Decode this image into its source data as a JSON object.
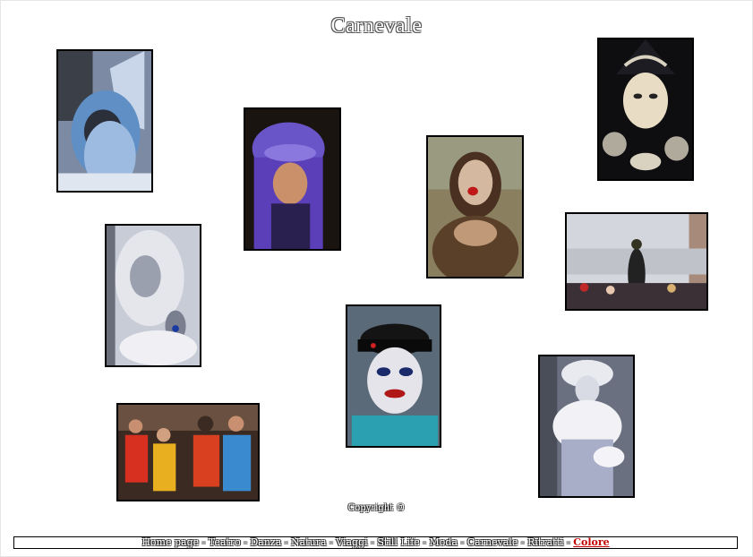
{
  "page": {
    "title": "Carnevale"
  },
  "copyright": "Copyright ©",
  "nav": {
    "items": [
      {
        "label": "Home page"
      },
      {
        "label": "Teatro"
      },
      {
        "label": "Danza"
      },
      {
        "label": "Natura"
      },
      {
        "label": "Viaggi"
      },
      {
        "label": "Still Life"
      },
      {
        "label": "Moda"
      },
      {
        "label": "Carnevale"
      },
      {
        "label": "Ritratti"
      },
      {
        "label": "Colore"
      }
    ],
    "separator": " - ",
    "active_color": "#c40000"
  }
}
